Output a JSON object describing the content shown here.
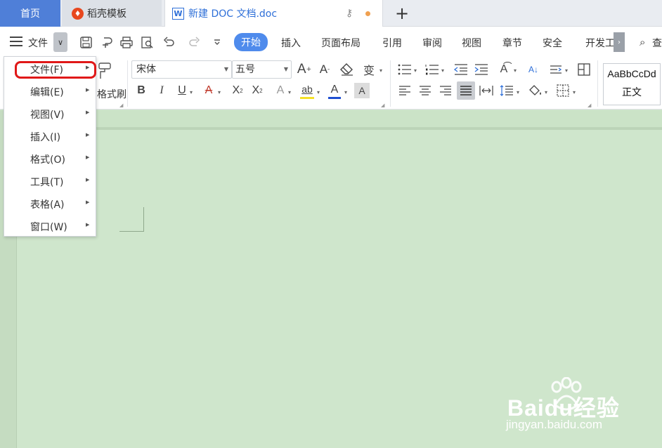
{
  "tabs": {
    "home": "首页",
    "daoke": "稻壳模板",
    "doc": "新建 DOC 文档.doc"
  },
  "menubar": {
    "file_label": "文件",
    "tabs": [
      "开始",
      "插入",
      "页面布局",
      "引用",
      "审阅",
      "视图",
      "章节",
      "安全",
      "开发工",
      "查"
    ]
  },
  "toolbar": {
    "format_brush": "格式刷",
    "font_name": "宋体",
    "font_size": "五号",
    "style_sample": "AaBbCcDd",
    "style_name": "正文"
  },
  "file_menu": {
    "items": [
      "文件(F)",
      "编辑(E)",
      "视图(V)",
      "插入(I)",
      "格式(O)",
      "工具(T)",
      "表格(A)",
      "窗口(W)"
    ]
  },
  "colors": {
    "accent": "#4f7fd8",
    "active_tab": "#4f8bec",
    "highlight_ring": "#e01818",
    "doc_bg": "#cfe6cc"
  },
  "watermark": {
    "brand": "Baidu经验",
    "url": "jingyan.baidu.com"
  }
}
